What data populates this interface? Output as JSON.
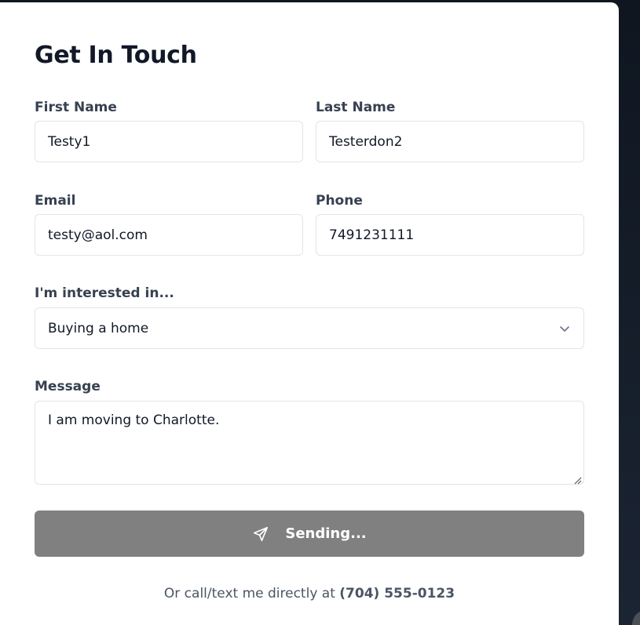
{
  "form": {
    "title": "Get In Touch",
    "first_name": {
      "label": "First Name",
      "value": "Testy1"
    },
    "last_name": {
      "label": "Last Name",
      "value": "Testerdon2"
    },
    "email": {
      "label": "Email",
      "value": "testy@aol.com"
    },
    "phone": {
      "label": "Phone",
      "value": "7491231111"
    },
    "interest": {
      "label": "I'm interested in...",
      "value": "Buying a home"
    },
    "message": {
      "label": "Message",
      "value": "I am moving to Charlotte."
    },
    "submit_label": "Sending...",
    "footer_text": "Or call/text me directly at",
    "footer_phone": "(704) 555-0123"
  },
  "icons": {
    "submit": "send-icon",
    "select": "chevron-down-icon",
    "textarea": "resize-handle-icon"
  },
  "colors": {
    "submit_bg": "#808080",
    "title": "#111827",
    "label": "#374151",
    "field_border": "#e2e4e8",
    "background": "#111827"
  }
}
